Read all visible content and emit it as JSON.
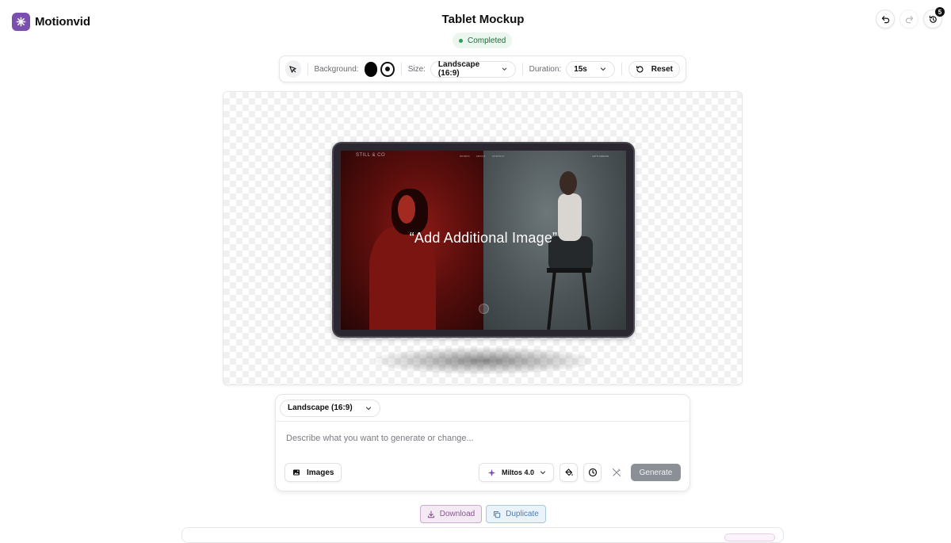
{
  "app": {
    "name": "Motionvid",
    "brand_color": "#7a4fb0"
  },
  "project": {
    "title": "Tablet Mockup",
    "status": "Completed",
    "status_color": "#2f9e55"
  },
  "top_right": {
    "undo_icon": "undo-icon",
    "redo_icon": "redo-icon",
    "history_icon": "history-icon",
    "history_count": "5"
  },
  "toolbar": {
    "select_icon": "cursor-icon",
    "background_label": "Background:",
    "background_options": [
      "black",
      "white"
    ],
    "size_label": "Size:",
    "size_value": "Landscape (16:9)",
    "duration_label": "Duration:",
    "duration_value": "15s",
    "reset_label": "Reset"
  },
  "canvas": {
    "screen": {
      "brand": "STILL & CO",
      "nav_items": [
        "WORKS",
        "ABOUT",
        "CONTACT"
      ],
      "cta": "LET'S CREATE",
      "caption": "“Add Additional Image”"
    }
  },
  "prompt": {
    "aspect_value": "Landscape (16:9)",
    "placeholder": "Describe what you want to generate or change...",
    "images_label": "Images",
    "model_label": "Miltos 4.0",
    "generate_label": "Generate"
  },
  "actions": {
    "download_label": "Download",
    "duplicate_label": "Duplicate"
  }
}
